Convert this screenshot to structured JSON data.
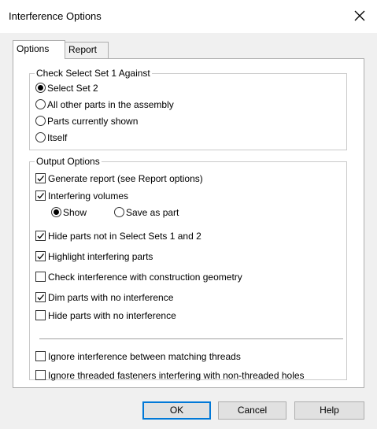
{
  "window": {
    "title": "Interference Options"
  },
  "tabs": [
    {
      "label": "Options",
      "active": true
    },
    {
      "label": "Report",
      "active": false
    }
  ],
  "check_group": {
    "legend": "Check Select Set 1 Against",
    "options": [
      {
        "label": "Select Set 2",
        "selected": true
      },
      {
        "label": "All other parts in the assembly",
        "selected": false
      },
      {
        "label": "Parts currently shown",
        "selected": false
      },
      {
        "label": "Itself",
        "selected": false
      }
    ]
  },
  "output_group": {
    "legend": "Output Options",
    "generate_report": {
      "label": "Generate report (see Report options)",
      "checked": true
    },
    "interfering_volumes": {
      "label": "Interfering volumes",
      "checked": true
    },
    "volume_mode": [
      {
        "label": "Show",
        "selected": true
      },
      {
        "label": "Save as part",
        "selected": false
      }
    ],
    "hide_not_in_sets": {
      "label": "Hide parts not in Select Sets 1 and 2",
      "checked": true
    },
    "highlight": {
      "label": "Highlight interfering parts",
      "checked": true
    },
    "construction": {
      "label": "Check interference with construction geometry",
      "checked": false
    },
    "dim_no_interference": {
      "label": "Dim parts with no interference",
      "checked": true
    },
    "hide_no_interference": {
      "label": "Hide parts with no interference",
      "checked": false
    },
    "ignore_threads": {
      "label": "Ignore interference between matching threads",
      "checked": false
    },
    "ignore_fasteners": {
      "label": "Ignore threaded fasteners interfering with non-threaded holes",
      "checked": false
    }
  },
  "buttons": {
    "ok": "OK",
    "cancel": "Cancel",
    "help": "Help"
  },
  "colors": {
    "focus_border": "#0078d7",
    "dialog_bg": "#f0f0f0"
  }
}
